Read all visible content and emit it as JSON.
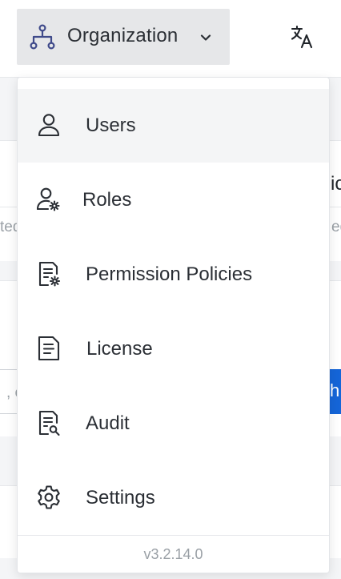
{
  "header": {
    "org_button_label": "Organization",
    "org_icon": "hierarchy-icon",
    "chevron_icon": "chevron-down-icon",
    "translate_icon": "translate-icon"
  },
  "background": {
    "fragment_left_1": "ted",
    "fragment_right_1": "ed",
    "fragment_right_title": "ic",
    "fragment_input": ", c",
    "fragment_button": "h"
  },
  "menu": {
    "items": [
      {
        "label": "Users",
        "icon": "user-icon",
        "active": true
      },
      {
        "label": "Roles",
        "icon": "user-settings-icon",
        "active": false
      },
      {
        "label": "Permission Policies",
        "icon": "document-settings-icon",
        "active": false
      },
      {
        "label": "License",
        "icon": "document-icon",
        "active": false
      },
      {
        "label": "Audit",
        "icon": "document-search-icon",
        "active": false
      },
      {
        "label": "Settings",
        "icon": "gear-icon",
        "active": false
      }
    ],
    "version": "v3.2.14.0"
  },
  "colors": {
    "accent": "#1565d8",
    "icon_stroke": "#2b2f35",
    "org_icon": "#3f4a8a",
    "menu_active_bg": "#f4f5f6"
  }
}
